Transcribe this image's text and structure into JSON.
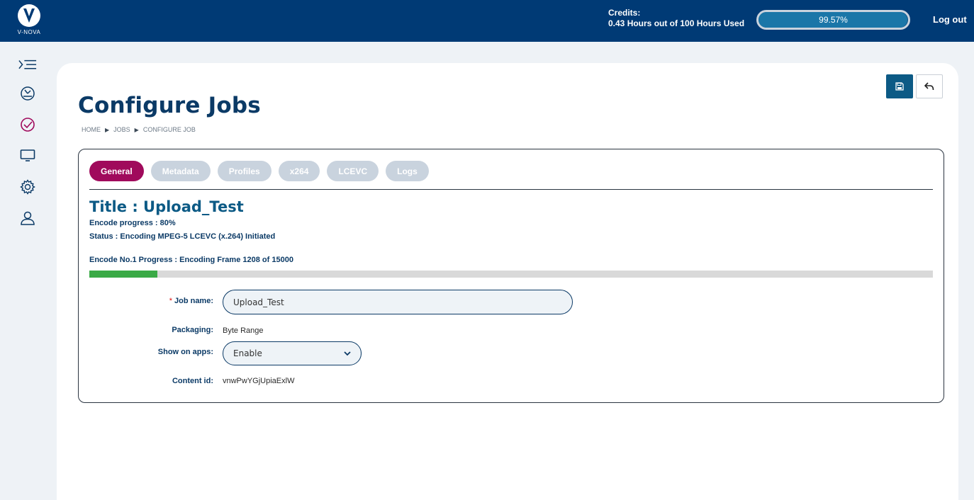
{
  "brand": {
    "logo_text": "V-NOVA"
  },
  "header": {
    "credits_label": "Credits:",
    "credits_usage": "0.43 Hours out of 100 Hours Used",
    "credits_percent": "99.57%",
    "credits_fill": 0.9957,
    "logout_label": "Log out"
  },
  "sidebar": {
    "icons": [
      "menu-toggle-icon",
      "dashboard-icon",
      "jobs-check-icon",
      "monitor-icon",
      "settings-gear-icon",
      "user-icon"
    ]
  },
  "page": {
    "title": "Configure Jobs",
    "breadcrumb": [
      "HOME",
      "JOBS",
      "CONFIGURE JOB"
    ],
    "breadcrumb_separator": "▶"
  },
  "tabs": [
    {
      "label": "General",
      "active": true
    },
    {
      "label": "Metadata",
      "active": false
    },
    {
      "label": "Profiles",
      "active": false
    },
    {
      "label": "x264",
      "active": false
    },
    {
      "label": "LCEVC",
      "active": false
    },
    {
      "label": "Logs",
      "active": false
    }
  ],
  "job": {
    "title": "Title : Upload_Test",
    "encode_progress": "Encode progress : 80%",
    "status": "Status : Encoding MPEG-5 LCEVC (x.264) Initiated",
    "encode_no1": "Encode No.1 Progress : Encoding Frame 1208 of 15000",
    "frame_progress": 0.0805
  },
  "form": {
    "required_mark": "*",
    "job_name_label": "Job name:",
    "job_name_value": "Upload_Test",
    "packaging_label": "Packaging:",
    "packaging_value": "Byte Range",
    "show_on_apps_label": "Show on apps:",
    "show_on_apps_value": "Enable",
    "content_id_label": "Content id:",
    "content_id_value": "vnwPwYGjUpiaExlW"
  },
  "colors": {
    "header_bg": "#003a75",
    "active_tab": "#a00a5c",
    "inactive_tab": "#c9d3de",
    "progress_green": "#3aaa46",
    "title_blue": "#0b3a66"
  }
}
